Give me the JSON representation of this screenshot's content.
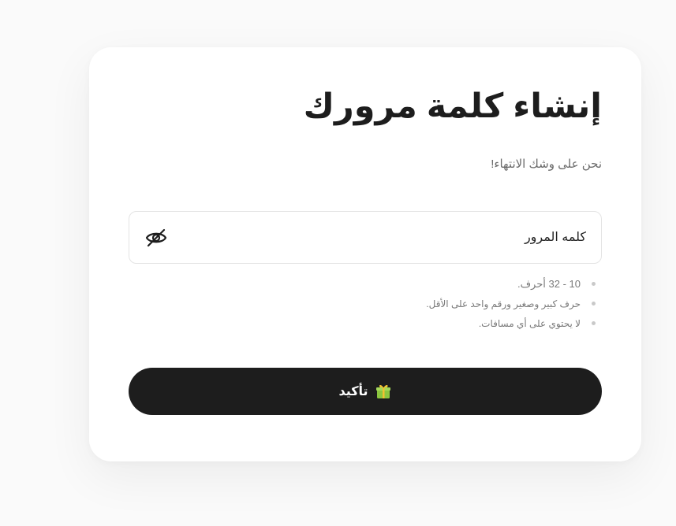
{
  "page": {
    "title": "إنشاء كلمة مرورك",
    "subtitle": "نحن على وشك الانتهاء!"
  },
  "password_field": {
    "placeholder": "كلمه المرور",
    "value": "",
    "toggle_icon": "eye-off-icon"
  },
  "rules": [
    "10 - 32 أحرف.",
    "حرف كبير وصغير ورقم واحد على الأقل.",
    "لا يحتوي على أي مسافات."
  ],
  "confirm_button": {
    "label": "تأكيد",
    "icon": "gift-icon"
  },
  "colors": {
    "button_bg": "#1d1d1d",
    "text_primary": "#1d1d1d",
    "text_muted": "#7a7a7a",
    "border": "#e4e4e4"
  }
}
